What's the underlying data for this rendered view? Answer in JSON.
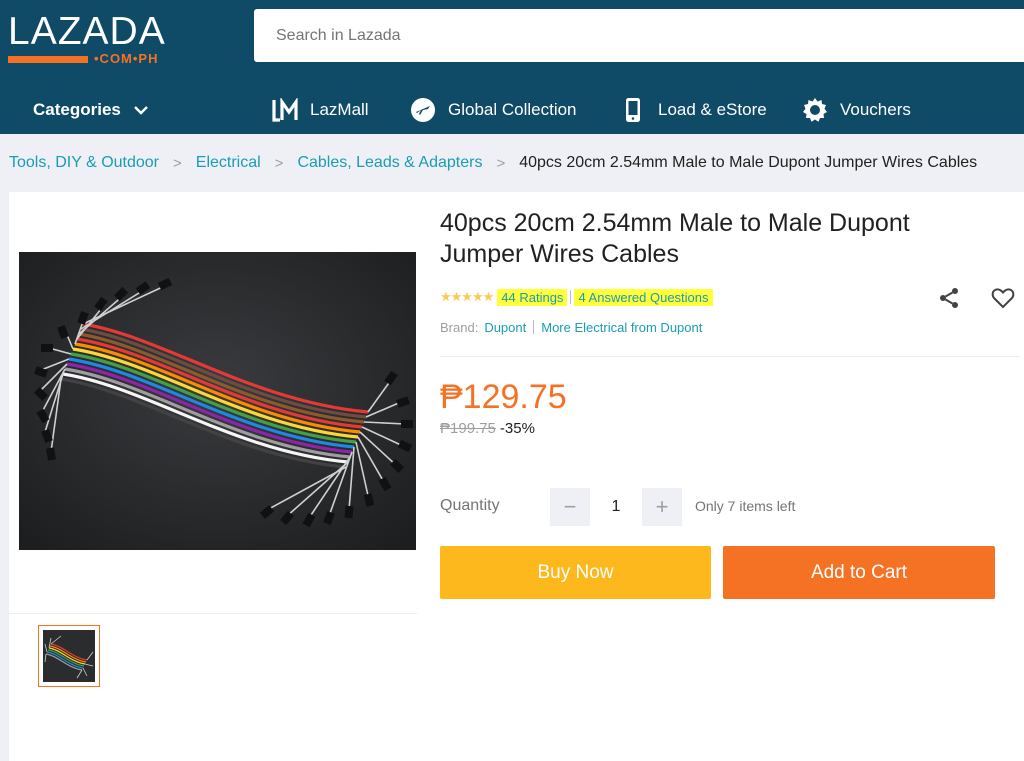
{
  "header": {
    "logo_text": "LAZADA",
    "logo_sub": "•COM•PH",
    "search_placeholder": "Search in Lazada"
  },
  "nav": {
    "categories_label": "Categories",
    "items": [
      {
        "label": "LazMall",
        "icon": "lazmall-icon"
      },
      {
        "label": "Global Collection",
        "icon": "airplane-icon"
      },
      {
        "label": "Load & eStore",
        "icon": "phone-icon"
      },
      {
        "label": "Vouchers",
        "icon": "voucher-badge-icon"
      }
    ]
  },
  "breadcrumb": [
    "Tools, DIY & Outdoor",
    "Electrical",
    "Cables, Leads & Adapters",
    "40pcs 20cm 2.54mm Male to Male Dupont Jumper Wires Cables"
  ],
  "product": {
    "title_line1": "40pcs 20cm 2.54mm Male to Male Dupont",
    "title_line2": "Jumper Wires Cables",
    "stars": "★★★★★",
    "rating_value": 4.5,
    "ratings_text": "44 Ratings",
    "questions_text": "4 Answered Questions",
    "brand_label": "Brand:",
    "brand_name": "Dupont",
    "more_from": "More Electrical from Dupont",
    "price": "₱129.75",
    "old_price": "₱199.75",
    "discount": "-35%",
    "quantity_label": "Quantity",
    "quantity_value": "1",
    "minus": "−",
    "plus": "+",
    "stock_note": "Only 7 items left",
    "buy_now": "Buy Now",
    "add_to_cart": "Add to Cart"
  },
  "colors": {
    "header_bg": "#0f4a66",
    "accent_orange": "#f57224",
    "buy_yellow": "#fcb81c",
    "link_blue": "#1a9cb7",
    "highlight": "#ffff3a"
  }
}
